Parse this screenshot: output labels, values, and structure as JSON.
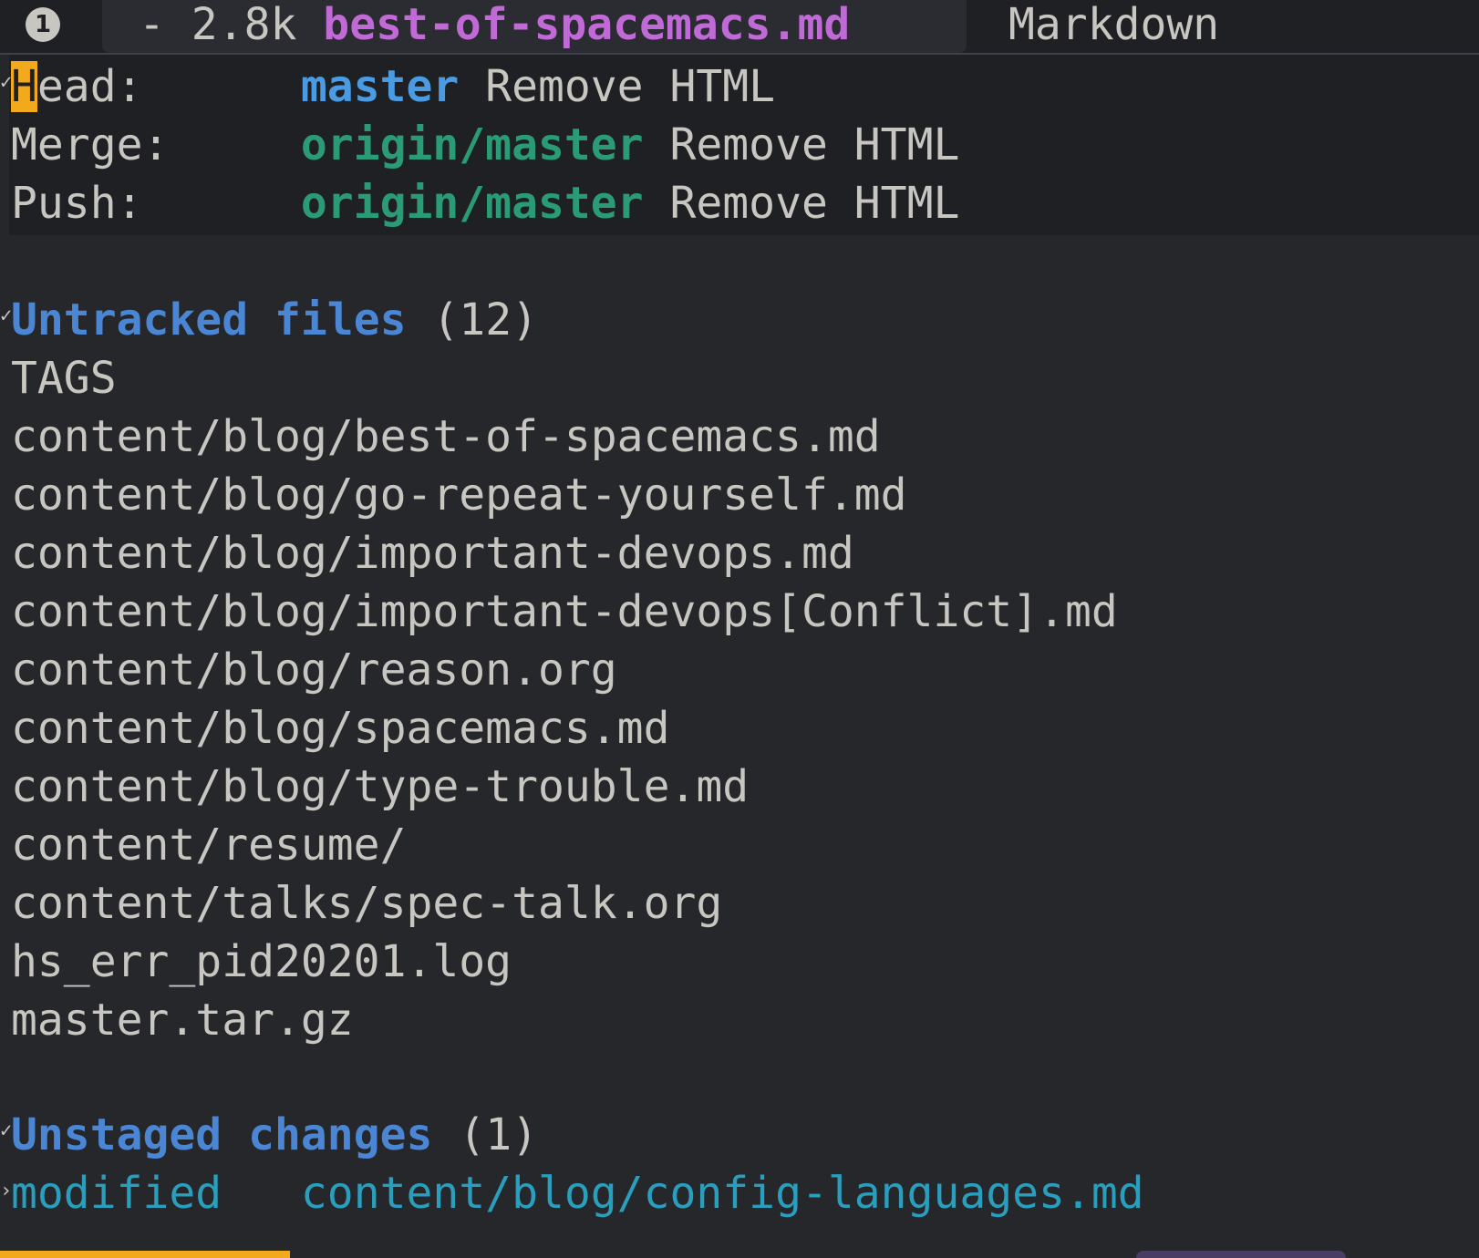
{
  "modeline": {
    "window_number": "1",
    "size": "- 2.8k",
    "filename": "best-of-spacemacs.md",
    "major_mode": "Markdown"
  },
  "header": {
    "head": {
      "label": "Head:",
      "branch": "master",
      "message": "Remove HTML",
      "cursor_char": "H",
      "rest_label": "ead:"
    },
    "merge": {
      "label": "Merge:",
      "branch": "origin/master",
      "message": "Remove HTML"
    },
    "push": {
      "label": "Push:",
      "branch": "origin/master",
      "message": "Remove HTML"
    }
  },
  "untracked": {
    "title_word1": "Untracked",
    "title_word2": "files",
    "count": "(12)",
    "files": [
      "TAGS",
      "content/blog/best-of-spacemacs.md",
      "content/blog/go-repeat-yourself.md",
      "content/blog/important-devops.md",
      "content/blog/important-devops[Conflict].md",
      "content/blog/reason.org",
      "content/blog/spacemacs.md",
      "content/blog/type-trouble.md",
      "content/resume/",
      "content/talks/spec-talk.org",
      "hs_err_pid20201.log",
      "master.tar.gz"
    ]
  },
  "unstaged": {
    "title_word1": "Unstaged",
    "title_word2": "changes",
    "count": "(1)",
    "items": [
      {
        "kind": "modified",
        "path": "content/blog/config-languages.md"
      }
    ]
  },
  "colors": {
    "background": "#26272b",
    "header_background": "#1f2023",
    "cursor": "#f2a91c",
    "local_branch": "#4a9be2",
    "remote_branch": "#2b9b75",
    "section_title": "#4a86d4",
    "filename_accent": "#c06ad6"
  }
}
